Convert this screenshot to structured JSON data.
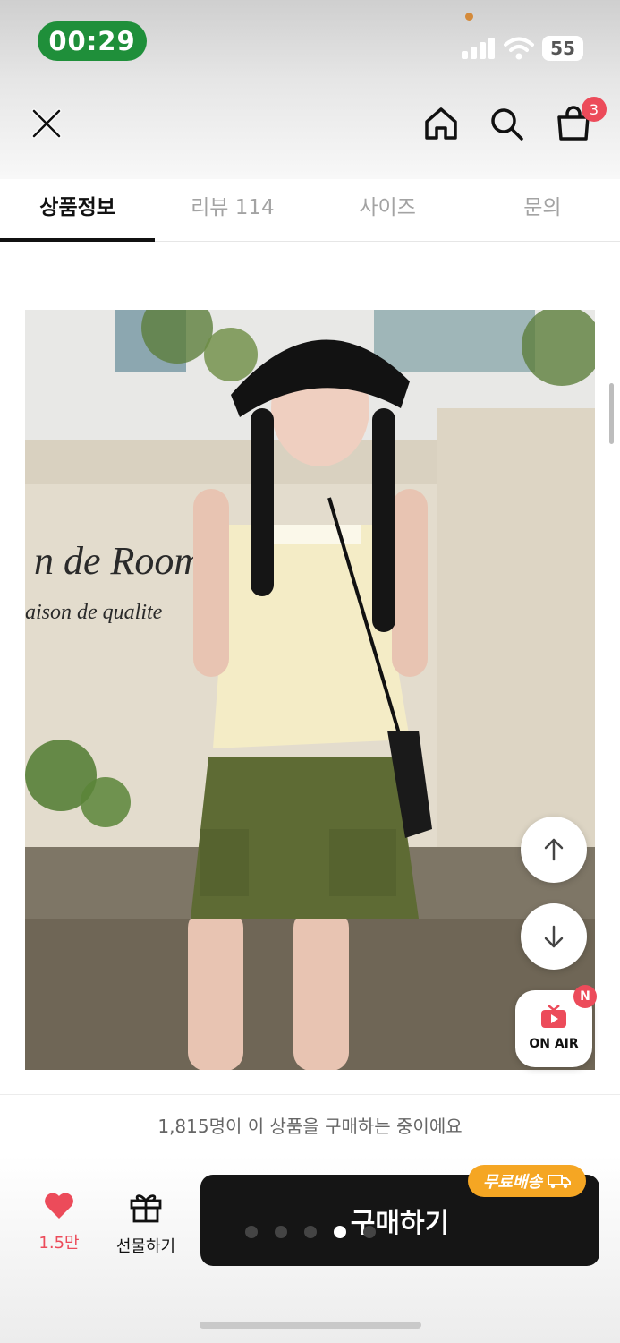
{
  "status_bar": {
    "time": "00:29",
    "battery": "55"
  },
  "nav": {
    "cart_count": "3"
  },
  "tabs": [
    {
      "label": "상품정보",
      "active": true
    },
    {
      "label": "리뷰 114",
      "active": false
    },
    {
      "label": "사이즈",
      "active": false
    },
    {
      "label": "문의",
      "active": false
    }
  ],
  "product_image": {
    "sign_line1": "n de Room",
    "sign_line2": "aison de qualite"
  },
  "floating": {
    "onair_label": "ON AIR",
    "onair_badge": "N"
  },
  "buyer_banner": "1,815명이 이 상품을 구매하는 중이에요",
  "bottom": {
    "like_count": "1.5만",
    "gift_label": "선물하기",
    "buy_label": "구매하기",
    "free_shipping": "무료배송",
    "pager_total": 5,
    "pager_active": 3
  },
  "colors": {
    "accent_red": "#ec4b5a",
    "status_green": "#1f8f3a",
    "free_ship_orange": "#f5a623",
    "buy_button": "#151515"
  }
}
